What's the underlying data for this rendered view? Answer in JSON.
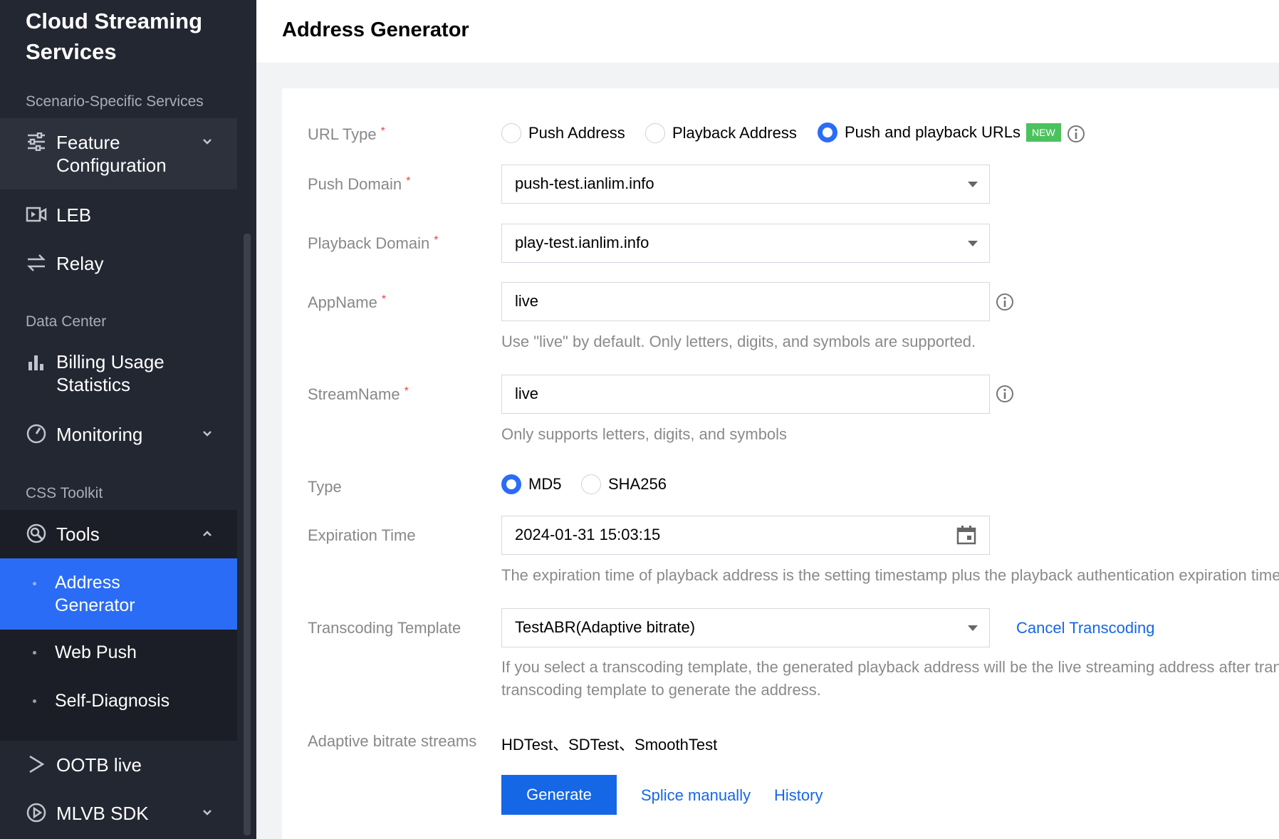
{
  "sidebar": {
    "brand": "Cloud Streaming Services",
    "sections": {
      "scenario": "Scenario-Specific Services",
      "data_center": "Data Center",
      "toolkit": "CSS Toolkit"
    },
    "items": {
      "feature_configuration": "Feature Configuration",
      "leb": "LEB",
      "relay": "Relay",
      "billing": "Billing Usage Statistics",
      "monitoring": "Monitoring",
      "tools": "Tools",
      "ootb": "OOTB live",
      "mlvb": "MLVB SDK"
    },
    "tools_sub": {
      "address_generator": "Address Generator",
      "web_push": "Web Push",
      "self_diagnosis": "Self-Diagnosis"
    }
  },
  "header": {
    "title": "Address Generator"
  },
  "form": {
    "url_type": {
      "label": "URL Type",
      "options": [
        "Push Address",
        "Playback Address",
        "Push and playback URLs"
      ],
      "selected": "Push and playback URLs",
      "new_badge": "NEW"
    },
    "push_domain": {
      "label": "Push Domain",
      "value": "push-test.ianlim.info"
    },
    "playback_domain": {
      "label": "Playback Domain",
      "value": "play-test.ianlim.info"
    },
    "app_name": {
      "label": "AppName",
      "value": "live",
      "hint": "Use \"live\" by default. Only letters, digits, and symbols are supported."
    },
    "stream_name": {
      "label": "StreamName",
      "value": "live",
      "hint": "Only supports letters, digits, and symbols"
    },
    "type": {
      "label": "Type",
      "options": [
        "MD5",
        "SHA256"
      ],
      "selected": "MD5"
    },
    "expiration": {
      "label": "Expiration Time",
      "value": "2024-01-31 15:03:15",
      "hint": "The expiration time of playback address is the setting timestamp plus the playback authentication expiration time"
    },
    "transcoding": {
      "label": "Transcoding Template",
      "value": "TestABR(Adaptive bitrate)",
      "cancel": "Cancel Transcoding",
      "hint_line1": "If you select a transcoding template, the generated playback address will be the live streaming address after trans",
      "hint_line2": "transcoding template to generate the address."
    },
    "abr": {
      "label": "Adaptive bitrate streams",
      "value": "HDTest、SDTest、SmoothTest"
    },
    "actions": {
      "generate": "Generate",
      "splice": "Splice manually",
      "history": "History"
    }
  },
  "colors": {
    "accent": "#1667e6",
    "sidebar_bg": "#232731",
    "active_bg": "#2a6cf6",
    "badge_new": "#4cc25e"
  }
}
